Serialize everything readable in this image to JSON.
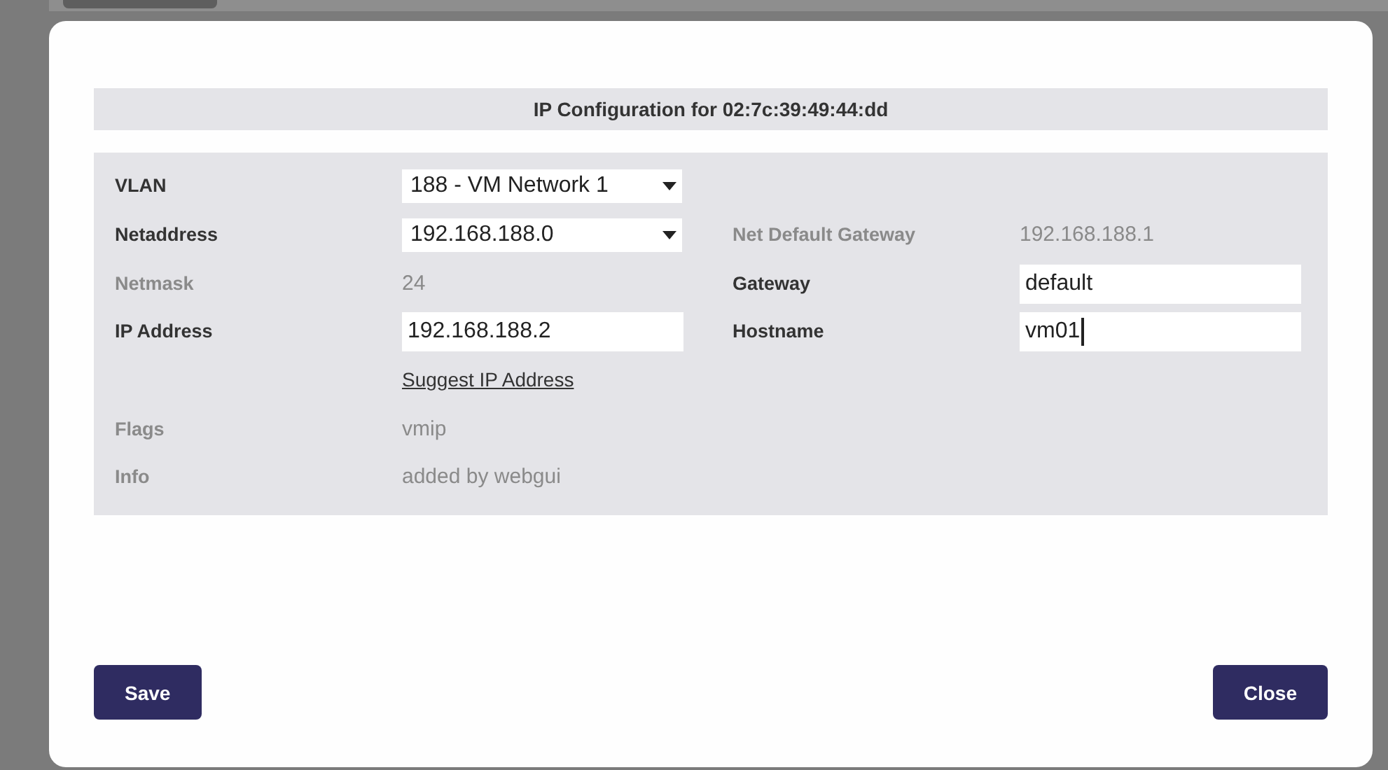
{
  "dialog": {
    "title": "IP Configuration for 02:7c:39:49:44:dd",
    "rows": [
      {
        "left": {
          "label": "VLAN",
          "disabled": false,
          "field": {
            "kind": "select",
            "value": "188 - VM Network 1"
          }
        }
      },
      {
        "left": {
          "label": "Netaddress",
          "disabled": false,
          "field": {
            "kind": "select",
            "value": "192.168.188.0"
          }
        },
        "right": {
          "label": "Net Default Gateway",
          "disabled": true,
          "field": {
            "kind": "text",
            "value": "192.168.188.1"
          }
        }
      },
      {
        "left": {
          "label": "Netmask",
          "disabled": true,
          "field": {
            "kind": "text",
            "value": "24"
          }
        },
        "right": {
          "label": "Gateway",
          "disabled": false,
          "field": {
            "kind": "input",
            "value": "default"
          }
        }
      },
      {
        "left": {
          "label": "IP Address",
          "disabled": false,
          "field": {
            "kind": "input",
            "value": "192.168.188.2"
          }
        },
        "right": {
          "label": "Hostname",
          "disabled": false,
          "field": {
            "kind": "input",
            "value": "vm01",
            "focused": true
          }
        }
      },
      {
        "left": {
          "field": {
            "kind": "link",
            "value": "Suggest IP Address"
          }
        }
      },
      {
        "left": {
          "label": "Flags",
          "disabled": true,
          "field": {
            "kind": "text",
            "value": "vmip"
          }
        }
      },
      {
        "left": {
          "label": "Info",
          "disabled": true,
          "field": {
            "kind": "text",
            "value": "added by webgui"
          }
        }
      }
    ],
    "buttons": [
      {
        "label": "Save"
      },
      {
        "label": "Close"
      }
    ]
  }
}
